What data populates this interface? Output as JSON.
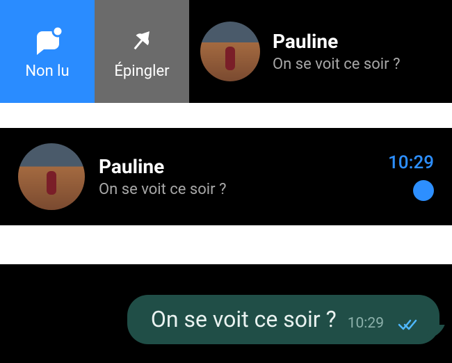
{
  "swipe": {
    "unread_label": "Non lu",
    "pin_label": "Épingler"
  },
  "chat1": {
    "name": "Pauline",
    "preview": "On se voit ce soir ?"
  },
  "chat2": {
    "name": "Pauline",
    "preview": "On se voit ce soir ?",
    "time": "10:29"
  },
  "bubble": {
    "text": "On se voit ce soir ?",
    "time": "10:29"
  },
  "colors": {
    "accent_blue": "#2d8fff",
    "bubble_bg": "#204e47"
  }
}
